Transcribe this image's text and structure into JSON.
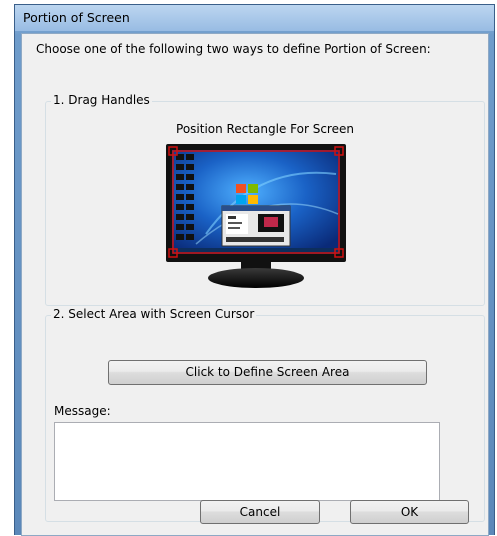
{
  "window": {
    "title": "Portion of Screen"
  },
  "instructions": "Choose one of the following two ways to define Portion of Screen:",
  "drag_group": {
    "legend": "1. Drag Handles",
    "position_label": "Position Rectangle For Screen"
  },
  "select_group": {
    "legend": "2. Select Area with Screen Cursor",
    "define_button": "Click to Define Screen Area",
    "message_label": "Message:",
    "message_value": ""
  },
  "buttons": {
    "cancel": "Cancel",
    "ok": "OK"
  },
  "colors": {
    "selection_rectangle": "#d01010",
    "monitor_bezel": "#111111",
    "desktop": "#1a62c6"
  },
  "icons": [
    "monitor-preview",
    "resize-handle"
  ]
}
